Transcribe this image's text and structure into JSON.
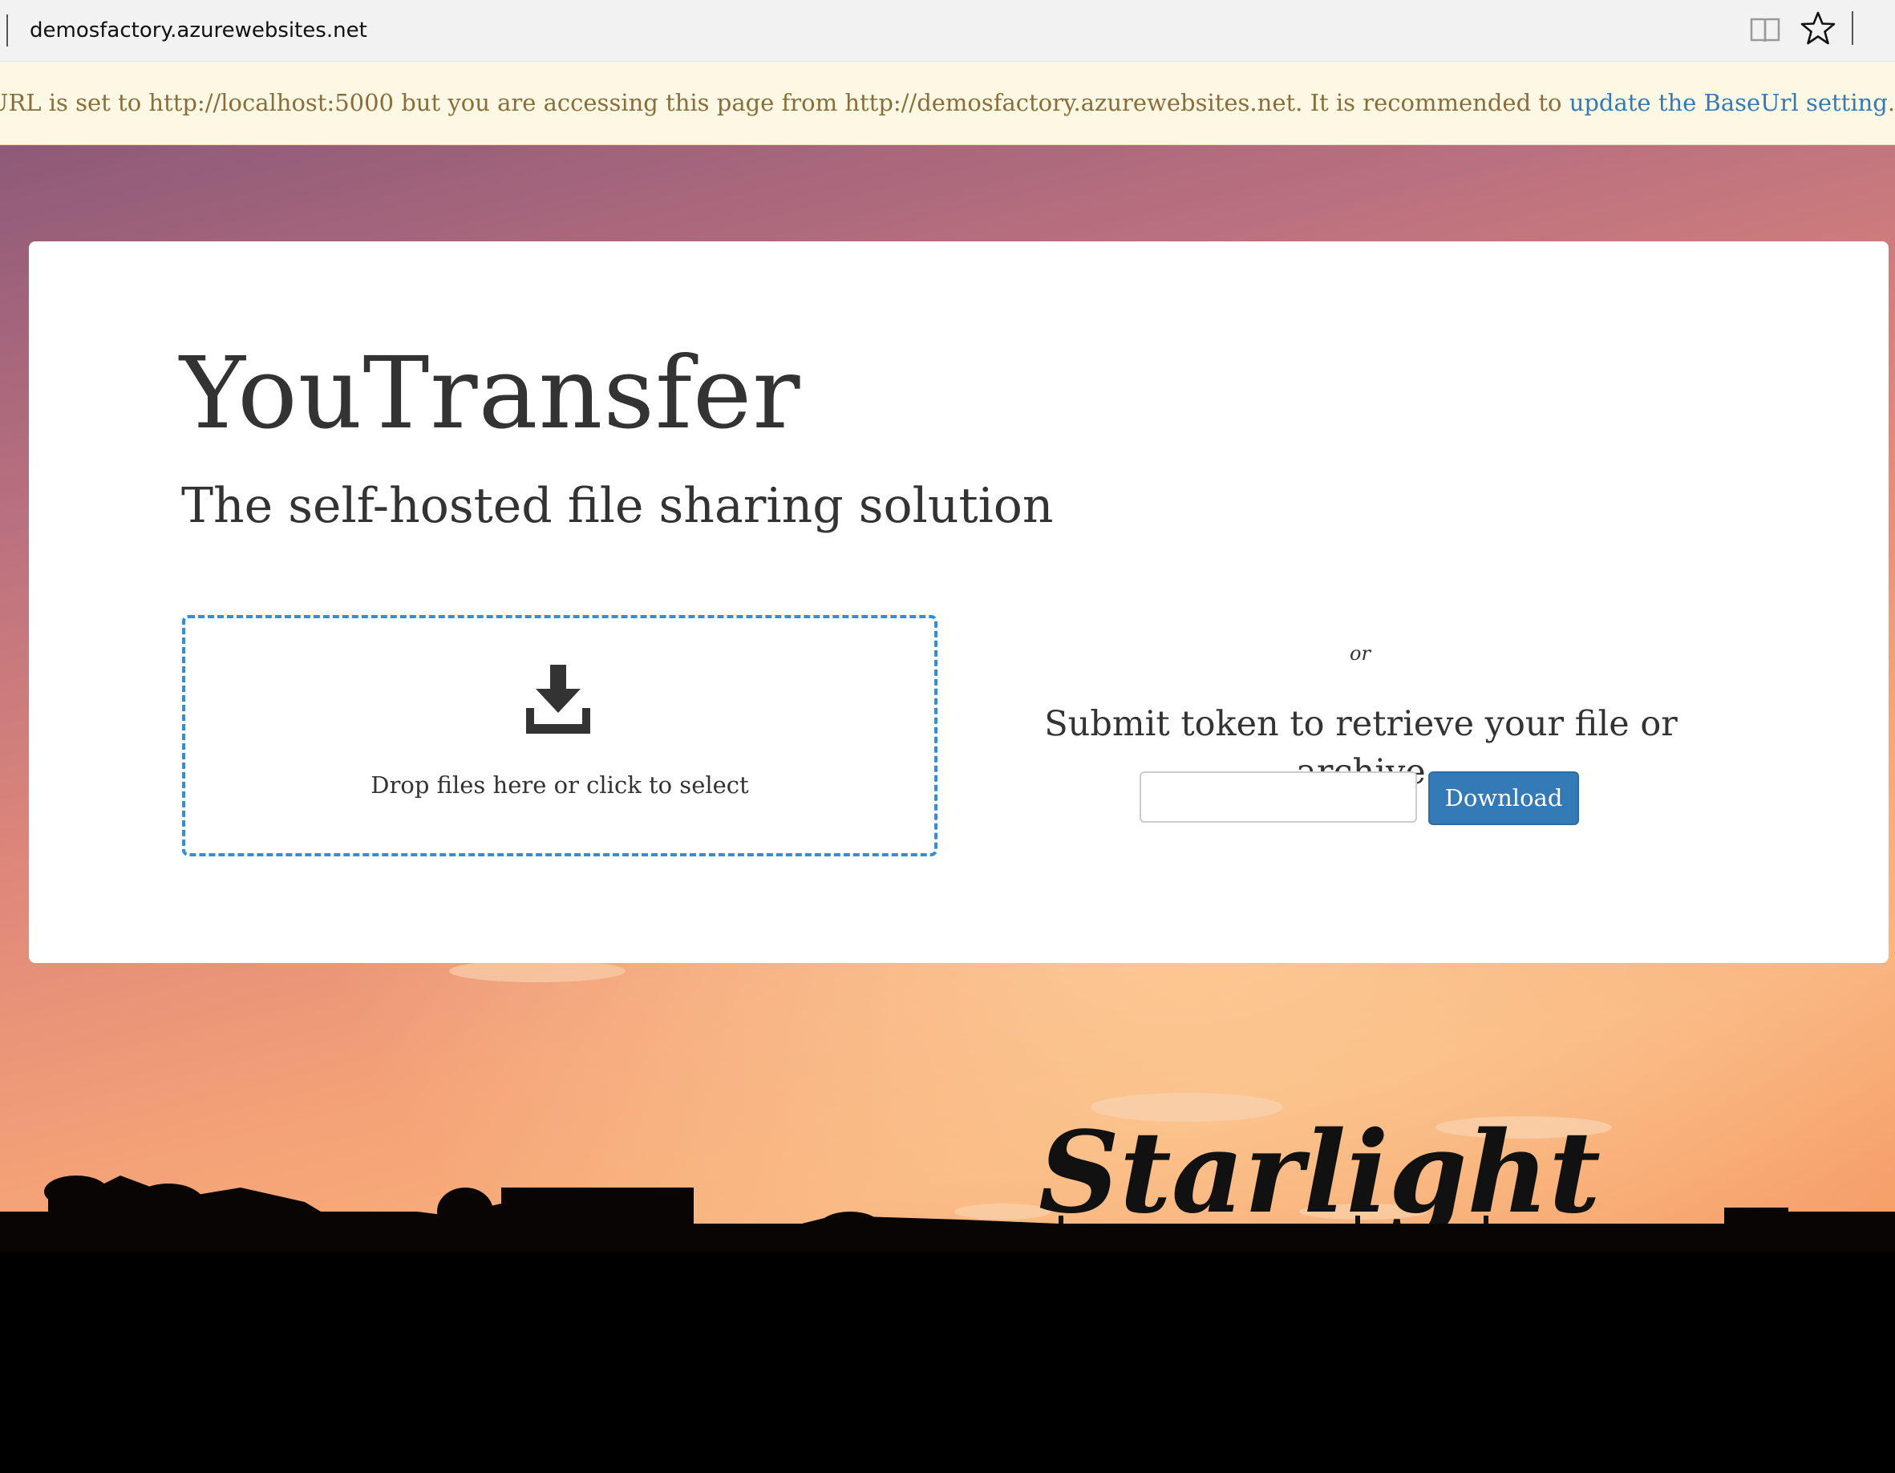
{
  "browser": {
    "url": "demosfactory.azurewebsites.net",
    "reading_view_icon": "book-icon",
    "favorite_icon": "star-icon"
  },
  "warning": {
    "text": "URL is set to http://localhost:5000 but you are accessing this page from http://demosfactory.azurewebsites.net. It is recommended to ",
    "link_label": "update the BaseUrl setting",
    "trailing": ".",
    "link_color": "#337ab7",
    "background": "#fcf8e3"
  },
  "hero": {
    "sign_text": "Starlight"
  },
  "app": {
    "title": "YouTransfer",
    "subtitle": "The self-hosted file sharing solution"
  },
  "upload": {
    "icon": "download-arrow-icon",
    "drop_text": "Drop files here or click to select",
    "border_color": "#2f8fd9"
  },
  "retrieve": {
    "or_text": "or",
    "heading": "Submit token to retrieve your file or archive",
    "token_input_value": "",
    "download_label": "Download",
    "button_color": "#337ab7"
  }
}
